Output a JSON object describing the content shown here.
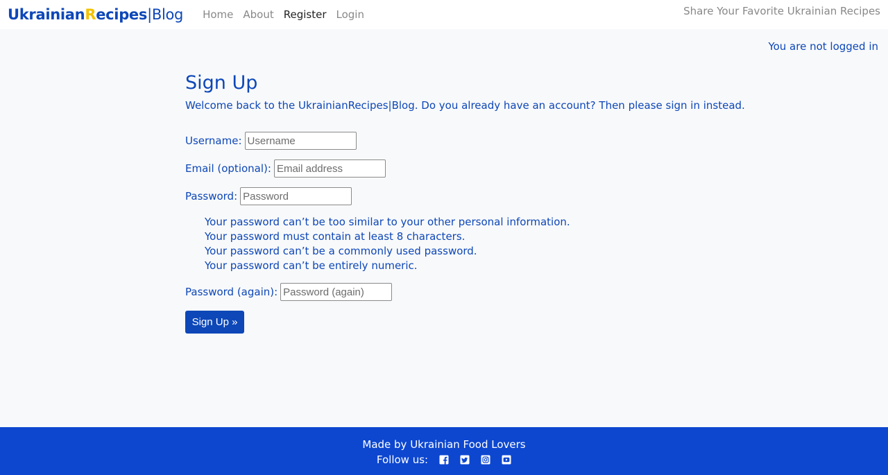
{
  "nav": {
    "brand": {
      "part1": "Ukrainian",
      "part2": "R",
      "part3": "ecipes",
      "part4": "|Blog"
    },
    "links": [
      {
        "label": "Home"
      },
      {
        "label": "About"
      },
      {
        "label": "Register"
      },
      {
        "label": "Login"
      }
    ],
    "right_label": "Share Your Favorite Ukrainian Recipes"
  },
  "status_text": "You are not logged in",
  "signup": {
    "title": "Sign Up",
    "welcome": "Welcome back to the UkrainianRecipes|Blog. Do you already have an account? Then please sign in instead.",
    "username": {
      "label": "Username:",
      "placeholder": "Username"
    },
    "email": {
      "label": "Email (optional):",
      "placeholder": "Email address"
    },
    "password": {
      "label": "Password:",
      "placeholder": "Password"
    },
    "help": [
      "Your password can’t be too similar to your other personal information.",
      "Your password must contain at least 8 characters.",
      "Your password can’t be a commonly used password.",
      "Your password can’t be entirely numeric."
    ],
    "password2": {
      "label": "Password (again):",
      "placeholder": "Password (again)"
    },
    "submit_label": "Sign Up »"
  },
  "footer": {
    "made_by": "Made by Ukrainian Food Lovers",
    "follow_label": "Follow us:",
    "social_icons": [
      "facebook-icon",
      "twitter-icon",
      "instagram-icon",
      "youtube-icon"
    ]
  },
  "colors": {
    "primary": "#0d47b8",
    "accent": "#f2c200",
    "footer_bg": "#0d47d0"
  }
}
